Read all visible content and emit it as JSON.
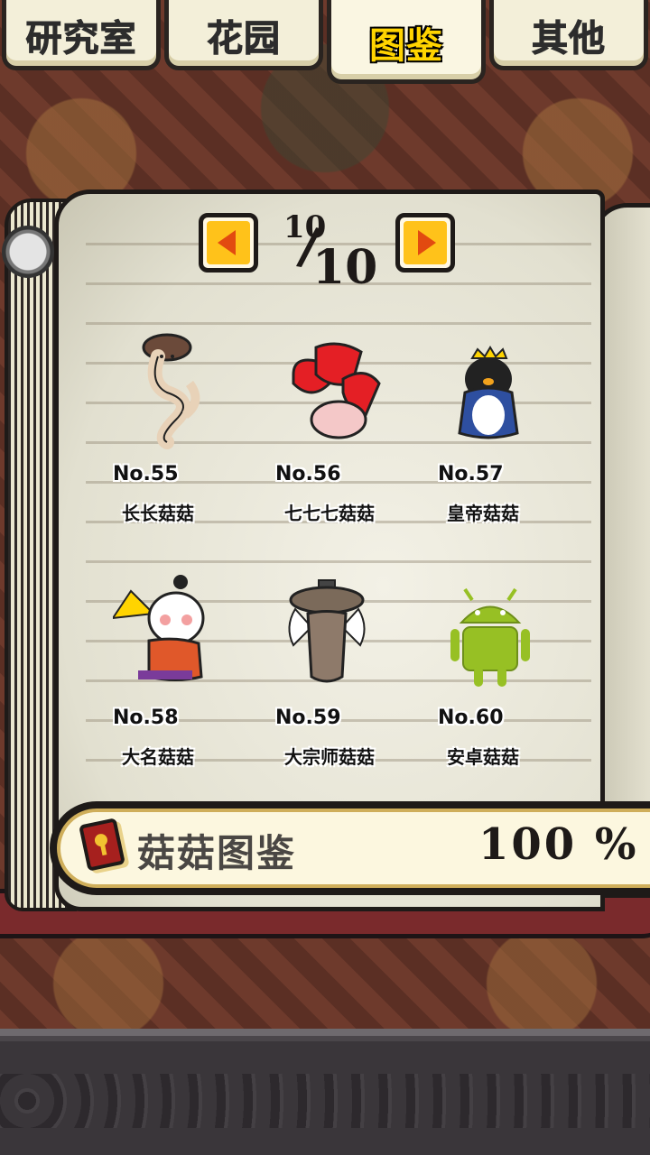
{
  "tabs": [
    {
      "label": "研究室",
      "active": false
    },
    {
      "label": "花园",
      "active": false
    },
    {
      "label": "图鉴",
      "active": true
    },
    {
      "label": "其他",
      "active": false
    }
  ],
  "pager": {
    "current": "10",
    "total": "10"
  },
  "items": [
    {
      "number": "No.55",
      "name": "长长菇菇",
      "icon": "long-mushroom-icon"
    },
    {
      "number": "No.56",
      "name": "七七七菇菇",
      "icon": "triple-seven-mushroom-icon"
    },
    {
      "number": "No.57",
      "name": "皇帝菇菇",
      "icon": "emperor-penguin-mushroom-icon"
    },
    {
      "number": "No.58",
      "name": "大名菇菇",
      "icon": "daimyo-mushroom-icon"
    },
    {
      "number": "No.59",
      "name": "大宗师菇菇",
      "icon": "grandmaster-mushroom-icon"
    },
    {
      "number": "No.60",
      "name": "安卓菇菇",
      "icon": "android-mushroom-icon"
    }
  ],
  "collection": {
    "title": "菇菇图鉴",
    "percent": "100 %"
  },
  "colors": {
    "accent": "#ffd400",
    "arrow": "#e24a10",
    "cover": "#7a2a2c"
  }
}
